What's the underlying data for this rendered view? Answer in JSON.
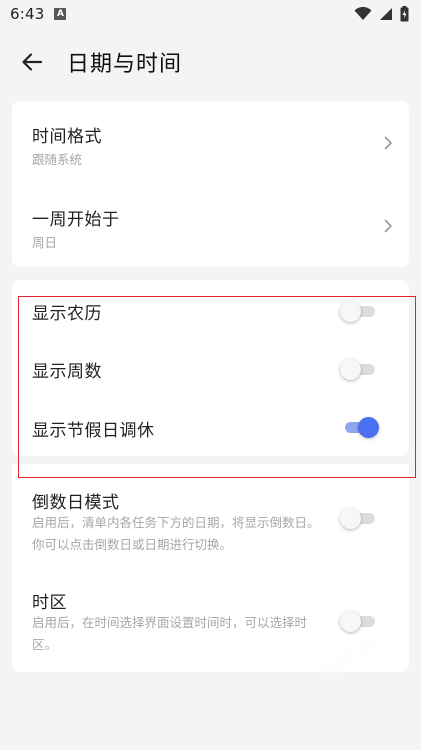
{
  "status_bar": {
    "time": "6:43",
    "notification_badge": "A"
  },
  "header": {
    "title": "日期与时间"
  },
  "settings": {
    "time_format": {
      "title": "时间格式",
      "value": "跟随系统"
    },
    "week_start": {
      "title": "一周开始于",
      "value": "周日"
    },
    "lunar": {
      "title": "显示农历",
      "enabled": false
    },
    "week_number": {
      "title": "显示周数",
      "enabled": false
    },
    "holidays": {
      "title": "显示节假日调休",
      "enabled": true
    },
    "countdown": {
      "title": "倒数日模式",
      "description": "启用后，清单内各任务下方的日期，将显示倒数日。你可以点击倒数日或日期进行切换。",
      "enabled": false
    },
    "timezone": {
      "title": "时区",
      "description": "启用后，在时间选择界面设置时间时，可以选择时区。",
      "enabled": false
    }
  },
  "watermark": "软件站",
  "colors": {
    "accent": "#4a6ff0",
    "highlight_border": "#e0242b",
    "background": "#f3f4f6"
  }
}
